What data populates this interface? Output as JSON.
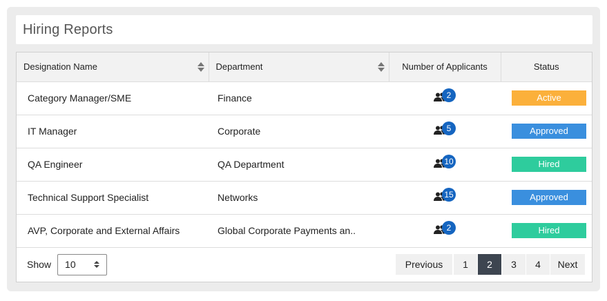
{
  "header": {
    "title": "Hiring Reports"
  },
  "table": {
    "columns": [
      "Designation Name",
      "Department",
      "Number of Applicants",
      "Status"
    ],
    "rows": [
      {
        "designation": "Category Manager/SME",
        "department": "Finance",
        "applicants": "2",
        "status": "Active"
      },
      {
        "designation": "IT Manager",
        "department": "Corporate",
        "applicants": "5",
        "status": "Approved"
      },
      {
        "designation": "QA Engineer",
        "department": "QA Department",
        "applicants": "10",
        "status": "Hired"
      },
      {
        "designation": "Technical Support Specialist",
        "department": "Networks",
        "applicants": "15",
        "status": "Approved"
      },
      {
        "designation": "AVP, Corporate and External Affairs",
        "department": "Global Corporate Payments an..",
        "applicants": "2",
        "status": "Hired"
      }
    ]
  },
  "status_colors": {
    "Active": "#fbb03b",
    "Approved": "#3a8fde",
    "Hired": "#2ecc9d"
  },
  "icons": {
    "applicants": "people-group-icon",
    "sort": "sort-icon",
    "select": "select-arrows-icon"
  },
  "footer": {
    "show_label": "Show",
    "page_size": "10",
    "pagination": {
      "prev": "Previous",
      "pages": [
        "1",
        "2",
        "3",
        "4"
      ],
      "current": "2",
      "next": "Next"
    }
  }
}
